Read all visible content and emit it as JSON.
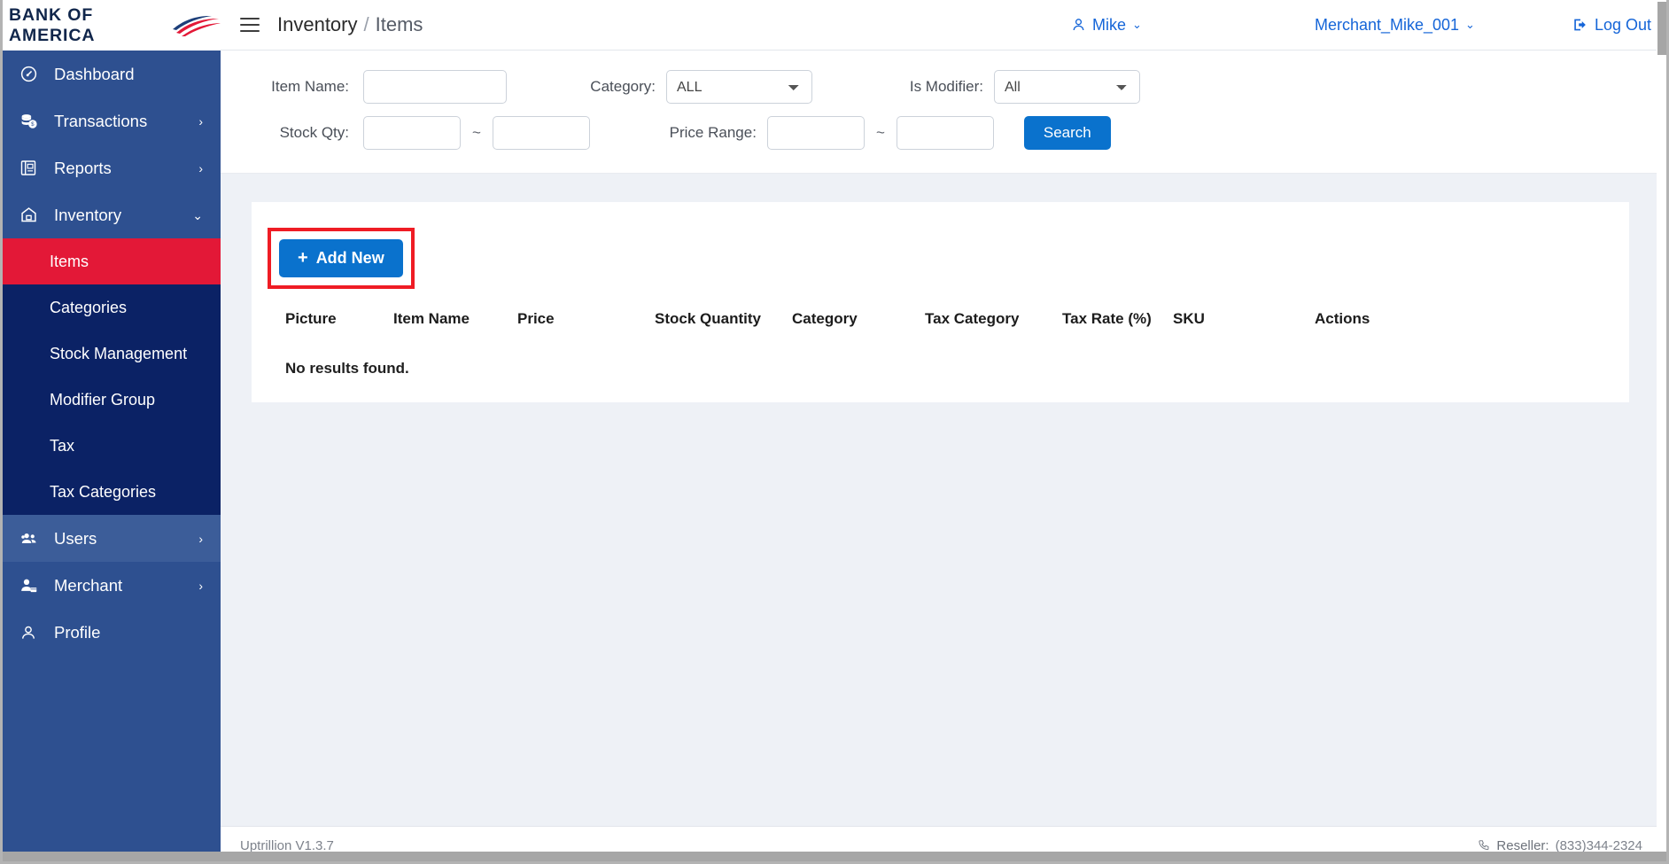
{
  "brand": {
    "name": "BANK OF AMERICA",
    "logo_icon": "bank-of-america-flag-icon"
  },
  "sidebar": {
    "items": [
      {
        "label": "Dashboard",
        "icon": "dashboard-gauge-icon",
        "chevron": ""
      },
      {
        "label": "Transactions",
        "icon": "money-coins-icon",
        "chevron": "›"
      },
      {
        "label": "Reports",
        "icon": "report-document-icon",
        "chevron": "›"
      },
      {
        "label": "Inventory",
        "icon": "home-inventory-icon",
        "chevron": "⌄"
      }
    ],
    "submenu": [
      {
        "label": "Items",
        "active": true
      },
      {
        "label": "Categories",
        "active": false
      },
      {
        "label": "Stock Management",
        "active": false
      },
      {
        "label": "Modifier Group",
        "active": false
      },
      {
        "label": "Tax",
        "active": false
      },
      {
        "label": "Tax Categories",
        "active": false
      }
    ],
    "items_bottom": [
      {
        "label": "Users",
        "icon": "users-group-icon",
        "chevron": "›"
      },
      {
        "label": "Merchant",
        "icon": "merchant-person-icon",
        "chevron": "›"
      },
      {
        "label": "Profile",
        "icon": "profile-person-icon",
        "chevron": ""
      }
    ]
  },
  "topbar": {
    "menu_icon": "hamburger-menu-icon",
    "breadcrumb_parent": "Inventory",
    "breadcrumb_separator": "/",
    "breadcrumb_current": "Items",
    "user_name": "Mike",
    "user_icon": "user-avatar-icon",
    "merchant_name": "Merchant_Mike_001",
    "caret": "⌄",
    "logout_label": "Log Out",
    "logout_icon": "logout-arrow-icon"
  },
  "filters": {
    "item_name_label": "Item Name:",
    "item_name_value": "",
    "item_name_placeholder": "",
    "category_label": "Category:",
    "category_value": "ALL",
    "category_options": [
      "ALL"
    ],
    "is_modifier_label": "Is Modifier:",
    "is_modifier_value": "All",
    "is_modifier_options": [
      "All"
    ],
    "stock_qty_label": "Stock Qty:",
    "stock_qty_min": "",
    "stock_qty_max": "",
    "price_range_label": "Price Range:",
    "price_min": "",
    "price_max": "",
    "range_separator": "~",
    "search_label": "Search"
  },
  "toolbar": {
    "add_new_label": "Add New",
    "add_new_plus": "+"
  },
  "table": {
    "columns": [
      "Picture",
      "Item Name",
      "Price",
      "Stock Quantity",
      "Category",
      "Tax Category",
      "Tax Rate (%)",
      "SKU",
      "Actions"
    ],
    "rows": [],
    "empty_message": "No results found."
  },
  "footer": {
    "version": "Uptrillion V1.3.7",
    "reseller_label": "Reseller:",
    "reseller_phone": "(833)344-2324",
    "phone_icon": "phone-icon"
  },
  "colors": {
    "sidebar_bg": "#2e5090",
    "submenu_bg": "#0b2265",
    "active_item": "#e31837",
    "primary_button": "#0a72cd",
    "highlight_box": "#ef1c24",
    "link_blue": "#1565d8"
  }
}
